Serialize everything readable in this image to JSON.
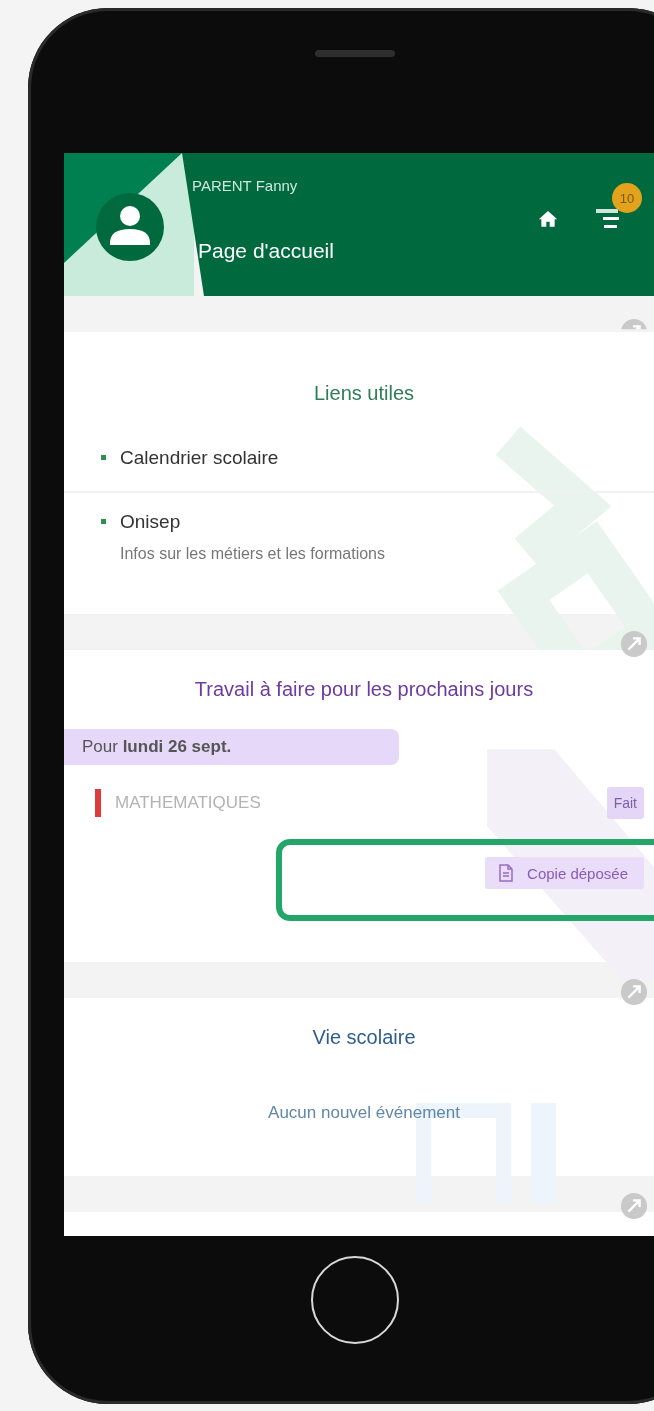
{
  "header": {
    "user": "PARENT Fanny",
    "title": "Page d'accueil",
    "badge": "10"
  },
  "links": {
    "title": "Liens utiles",
    "items": [
      {
        "label": "Calendrier scolaire"
      },
      {
        "label": "Onisep",
        "description": "Infos sur les métiers et les formations"
      }
    ]
  },
  "homework": {
    "title": "Travail à faire pour les prochains jours",
    "date": "Pour **lundi 26 sept.**",
    "subject": {
      "name": "MATHEMATIQUES",
      "color": "#e03b3b"
    },
    "status": "Fait",
    "done": true,
    "submission": "Copie déposée",
    "highlighted": true
  },
  "school_life": {
    "title": "Vie scolaire",
    "message": "Aucun nouvel événement"
  }
}
